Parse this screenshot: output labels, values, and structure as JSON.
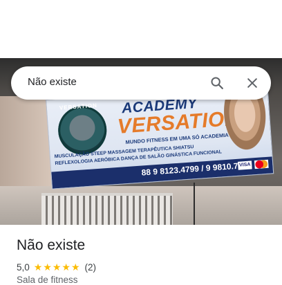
{
  "search": {
    "query": "Não existe"
  },
  "icons": {
    "search": "search-icon",
    "close": "close-icon"
  },
  "place": {
    "name": "Não existe",
    "rating": "5,0",
    "stars": "★★★★★",
    "review_count": "(2)",
    "category": "Sala de fitness"
  },
  "photo_sign": {
    "logo_text": "VERSATION",
    "title_line1": "ACADEMY",
    "title_line2": "VERSATION",
    "subtitle": "MUNDO FITNESS EM UMA SÓ ACADEMIA",
    "services": "MUSCULAÇÃO  STEEP  MASSAGEM TERAPÊUTICA SHIATSU REFLEXOLOGIA  AERÓBICA  DANÇA DE SALÃO  GINÁSTICA FUNCIONAL",
    "phones": "88 9 8123.4799 / 9 9810.7211",
    "card_visa": "VISA"
  },
  "colors": {
    "star": "#fbbc04",
    "banner_blue": "#1b3a7a",
    "banner_orange": "#e57b2a"
  }
}
